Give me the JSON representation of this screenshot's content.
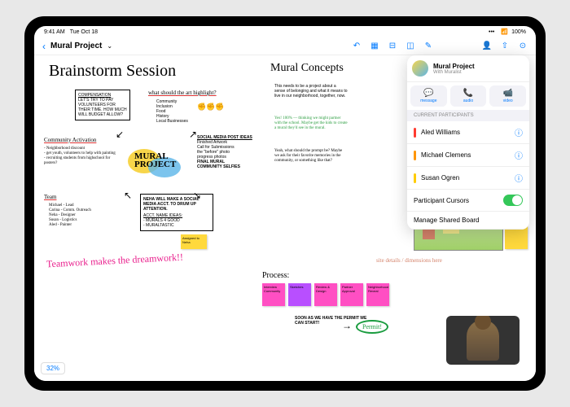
{
  "status": {
    "time": "9:41 AM",
    "date": "Tue Oct 18",
    "battery": "100%"
  },
  "toolbar": {
    "title": "Mural Project"
  },
  "canvas": {
    "title": "Brainstorm Session",
    "subtitle": "Mural Concepts",
    "highlight_q": "what should the art highlight?",
    "compensation": {
      "h": "COMPENSATION",
      "b": "LET'S TRY TO PAY VOLUNTEERS FOR THEIR TIME. HOW MUCH WILL BUDGET ALLOW?"
    },
    "highlights": [
      "Community",
      "Inclusion",
      "Food",
      "History",
      "Local Businesses"
    ],
    "social": {
      "h": "SOCIAL MEDIA POST IDEAS",
      "items": [
        "Finished Artwork",
        "Call for Submissions",
        "the \"before\" photo",
        "progress photos",
        "FINAL MURAL",
        "COMMUNITY SELFIES"
      ]
    },
    "comm_act": {
      "h": "Community Activation",
      "b": "- Neighborhood discount\n- get youth, volunteers to help with painting\n- recruiting students from highschool for posters?"
    },
    "team": {
      "h": "Team",
      "b": "Michael - Lead\nCarina - Comm. Outreach\nNeha - Designer\nSusan - Logistics\nAled - Painter"
    },
    "neha": {
      "b": "NEHA WILL MAKE A SOCIAL MEDIA ACCT. TO DRUM UP ATTENTION.",
      "h2": "ACCT. NAME IDEAS:",
      "ideas": "- MURALS 4 GOOD\n- MURALTASTIC"
    },
    "assigned": "Assigned to Neha",
    "teamwork": "Teamwork makes the dreamwork!!",
    "desc": "This needs to be a project about a sense of belonging and what it means to live in our neighborhood, together, now.",
    "yes": "Yes! 100% — thinking we might partner with the school. Maybe get the kids to create a mural they'd see in the mural.",
    "yeah": "Yeah, what should the prompt be? Maybe we ask for their favorite memories in the community, or something like that?",
    "details": "site details / dimensions here",
    "process": "Process:",
    "stickies": [
      "Interview Community",
      "Sketches",
      "Review & Design",
      "Partner Approval",
      "Neighborhood Reveal"
    ],
    "soon": "SOON AS WE HAVE THE PERMIT WE CAN START!",
    "permit": "Permit!",
    "zoom": "32%"
  },
  "panel": {
    "name": "Mural Project",
    "sub": "With Muralist",
    "actions": [
      {
        "l": "message"
      },
      {
        "l": "audio"
      },
      {
        "l": "video"
      }
    ],
    "sec": "CURRENT PARTICIPANTS",
    "participants": [
      {
        "n": "Aled Williams"
      },
      {
        "n": "Michael Clemens"
      },
      {
        "n": "Susan Ogren"
      }
    ],
    "cursors": "Participant Cursors",
    "manage": "Manage Shared Board"
  }
}
